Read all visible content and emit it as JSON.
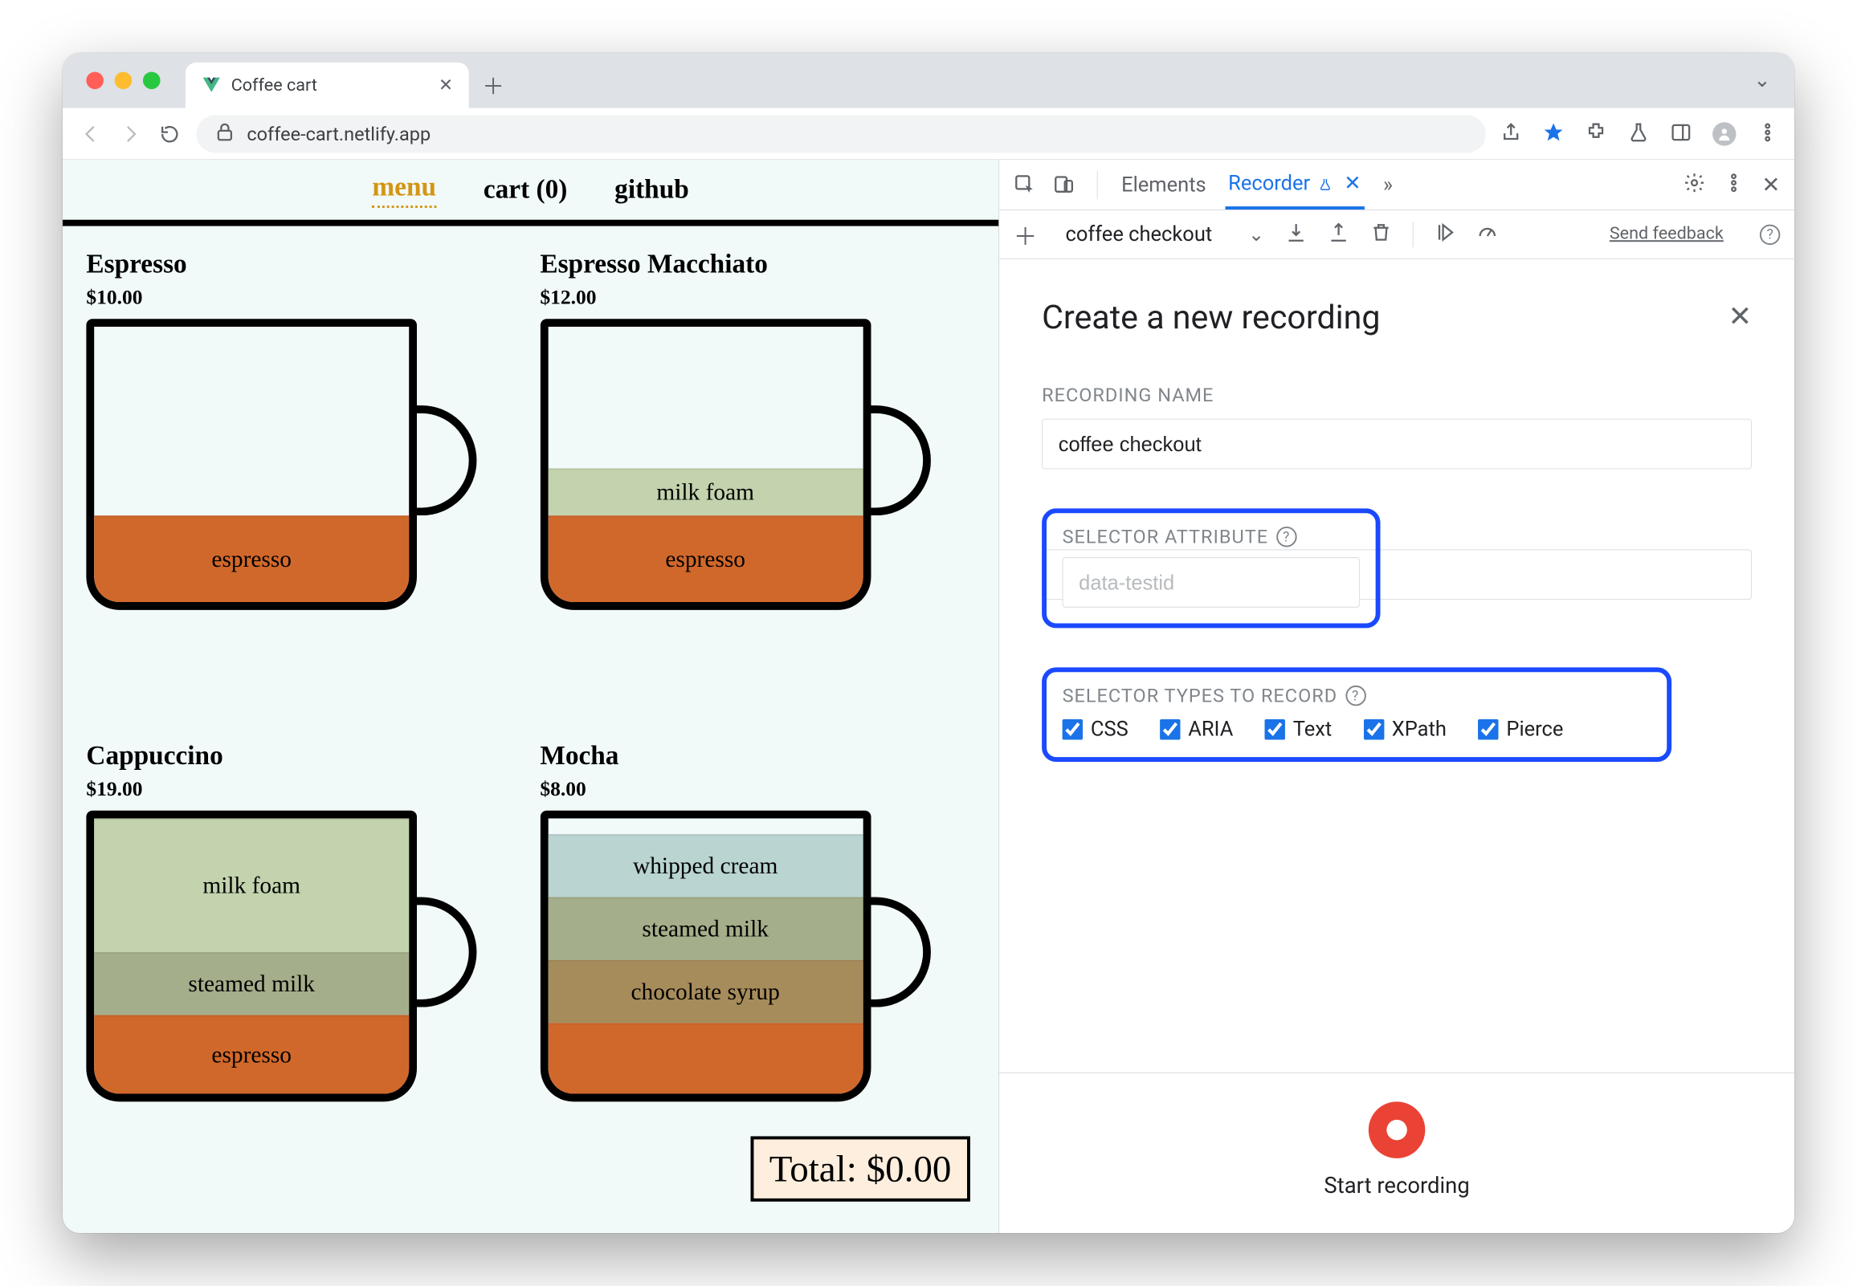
{
  "browser": {
    "tab_title": "Coffee cart",
    "url": "coffee-cart.netlify.app"
  },
  "page": {
    "nav": {
      "menu": "menu",
      "cart": "cart (0)",
      "github": "github"
    },
    "total_label": "Total: $0.00",
    "products": [
      {
        "name": "Espresso",
        "price": "$10.00",
        "layers": [
          {
            "label": "espresso",
            "colorClass": "c-espresso",
            "h": 110
          }
        ]
      },
      {
        "name": "Espresso Macchiato",
        "price": "$12.00",
        "layers": [
          {
            "label": "milk foam",
            "colorClass": "c-milkfoam",
            "h": 60
          },
          {
            "label": "espresso",
            "colorClass": "c-espresso",
            "h": 110
          }
        ]
      },
      {
        "name": "Cappuccino",
        "price": "$19.00",
        "layers": [
          {
            "label": "milk foam",
            "colorClass": "c-milkfoam",
            "h": 170
          },
          {
            "label": "steamed milk",
            "colorClass": "c-steamed",
            "h": 80
          },
          {
            "label": "espresso",
            "colorClass": "c-espresso",
            "h": 100
          }
        ]
      },
      {
        "name": "Mocha",
        "price": "$8.00",
        "layers": [
          {
            "label": "whipped cream",
            "colorClass": "c-whipped",
            "h": 80
          },
          {
            "label": "steamed milk",
            "colorClass": "c-steamed",
            "h": 80
          },
          {
            "label": "chocolate syrup",
            "colorClass": "c-choc",
            "h": 80
          },
          {
            "label": "",
            "colorClass": "c-espresso",
            "h": 90
          }
        ]
      }
    ]
  },
  "devtools": {
    "tabs": {
      "elements": "Elements",
      "recorder": "Recorder"
    },
    "toolbar": {
      "recording_name": "coffee checkout",
      "feedback": "Send feedback"
    },
    "panel": {
      "title": "Create a new recording",
      "name_label": "RECORDING NAME",
      "name_value": "coffee checkout",
      "attr_label": "SELECTOR ATTRIBUTE",
      "attr_placeholder": "data-testid",
      "types_label": "SELECTOR TYPES TO RECORD",
      "types": [
        {
          "label": "CSS",
          "checked": true
        },
        {
          "label": "ARIA",
          "checked": true
        },
        {
          "label": "Text",
          "checked": true
        },
        {
          "label": "XPath",
          "checked": true
        },
        {
          "label": "Pierce",
          "checked": true
        }
      ],
      "start_label": "Start recording"
    }
  }
}
